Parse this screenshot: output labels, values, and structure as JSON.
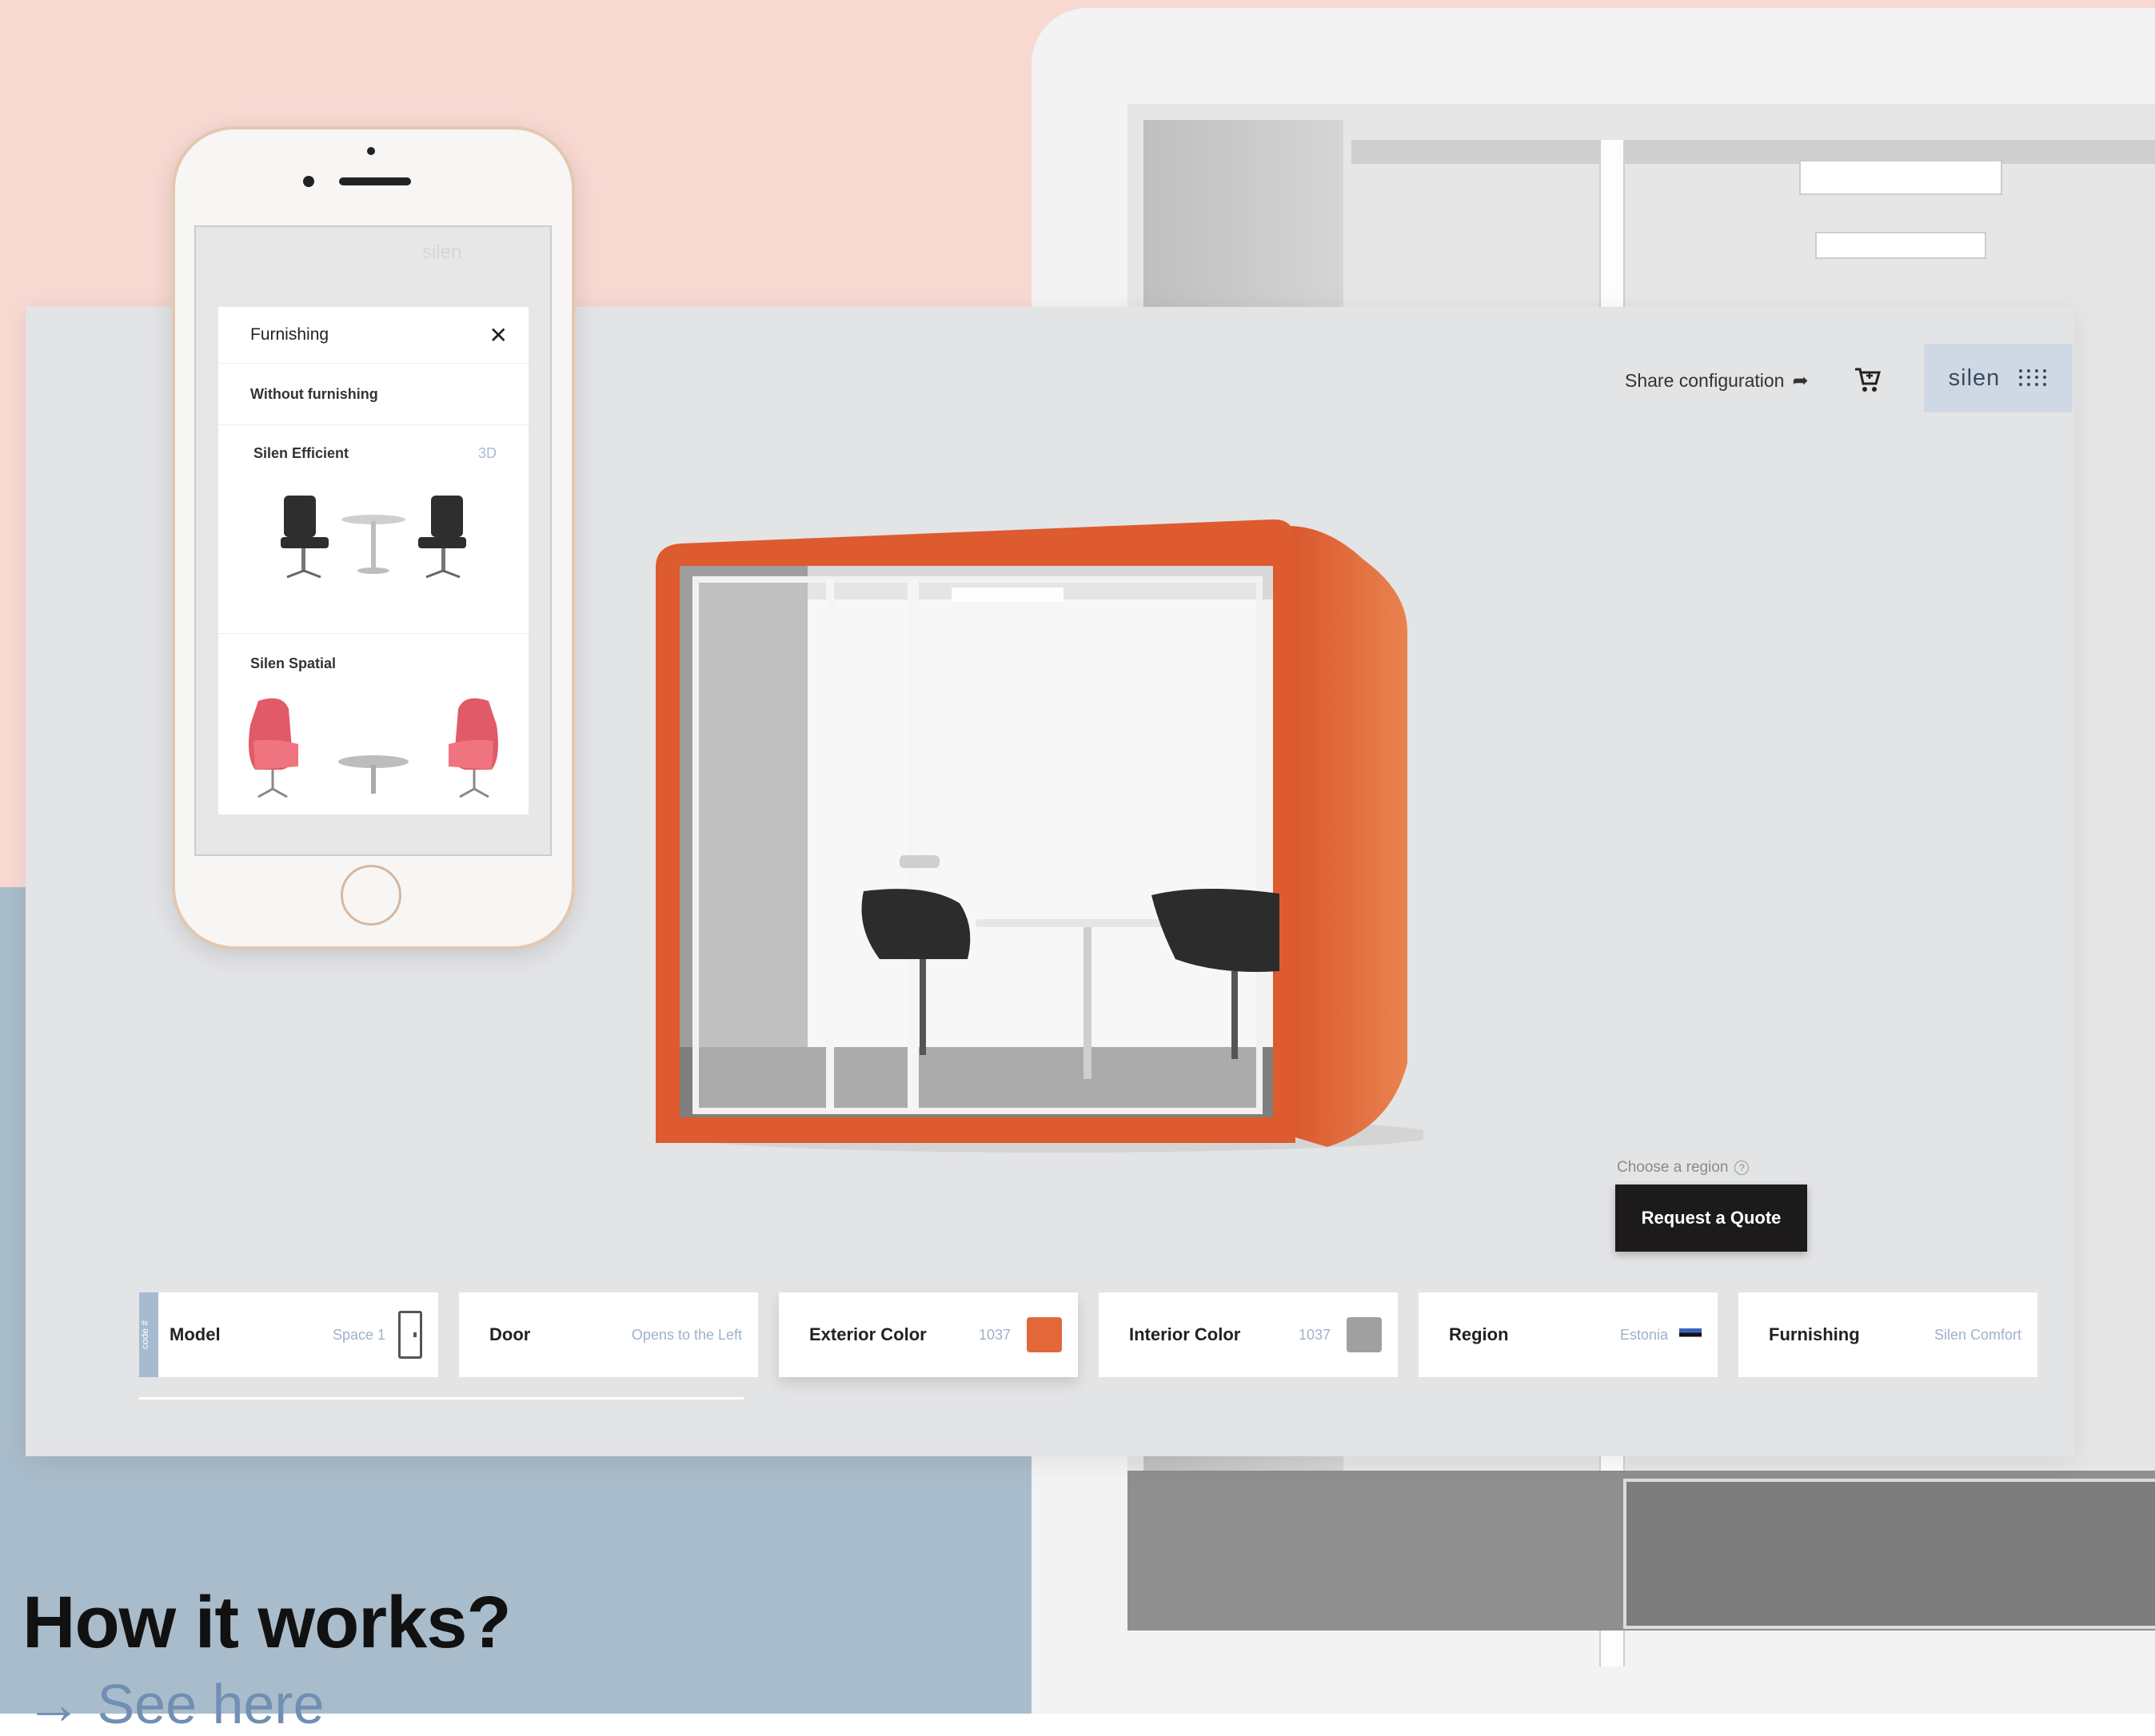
{
  "page": {
    "heading": "How it works?",
    "link": "→ See here"
  },
  "topbar": {
    "share_label": "Share configuration",
    "brand": "silen"
  },
  "quote": {
    "region_hint": "Choose a region",
    "button": "Request a Quote"
  },
  "options": [
    {
      "label": "Model",
      "value": "Space 1"
    },
    {
      "label": "Door",
      "value": "Opens to the Left"
    },
    {
      "label": "Exterior Color",
      "value": "1037",
      "swatch": "#e2683a"
    },
    {
      "label": "Interior Color",
      "value": "1037",
      "swatch": "#a0a0a0"
    },
    {
      "label": "Region",
      "value": "Estonia"
    },
    {
      "label": "Furnishing",
      "value": "Silen Comfort"
    }
  ],
  "code_tab": "code #",
  "colors": {
    "booth_exterior": "#e2683a",
    "accent_blue": "#a6bad0",
    "button_dark": "#1d1a1b"
  },
  "phone": {
    "brand": "silen",
    "panel_title": "Furnishing",
    "without": "Without furnishing",
    "item1": "Silen Efficient",
    "item1_tag": "3D",
    "item2": "Silen Spatial"
  }
}
